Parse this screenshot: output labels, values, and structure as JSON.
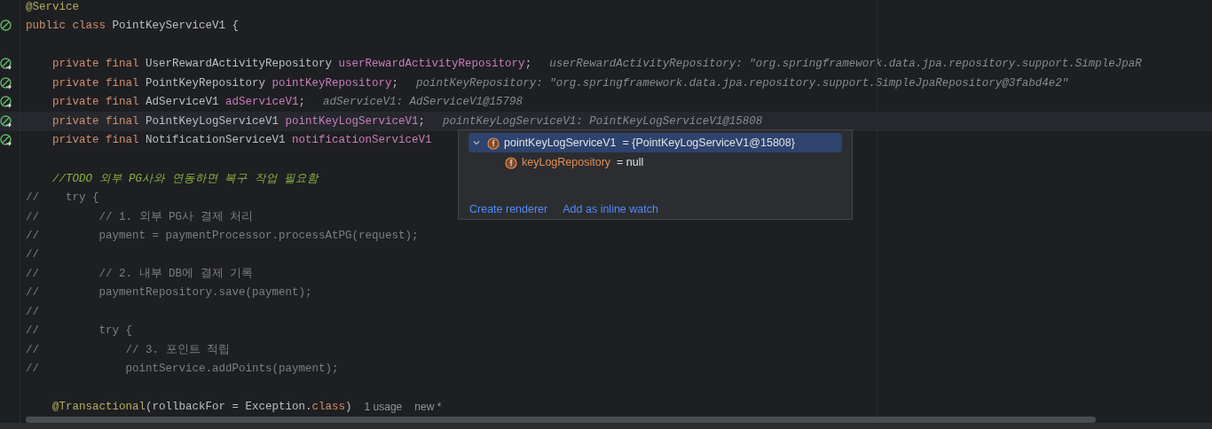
{
  "editor": {
    "lines": [
      {
        "kind": "code",
        "current": false,
        "tokens": [
          {
            "kind": "annotation",
            "text": "@Service"
          }
        ]
      },
      {
        "kind": "code",
        "gutter_icon": true,
        "current": false,
        "tokens": [
          {
            "kind": "keyword",
            "text": "public class "
          },
          {
            "kind": "plain",
            "text": "PointKeyServiceV1 {"
          }
        ]
      },
      {
        "kind": "blank"
      },
      {
        "kind": "code",
        "gutter_icon": true,
        "current": false,
        "tokens": [
          {
            "kind": "keyword",
            "text": "    private final "
          },
          {
            "kind": "plain",
            "text": "UserRewardActivityRepository "
          },
          {
            "kind": "field",
            "text": "userRewardActivityRepository"
          },
          {
            "kind": "plain",
            "text": ";"
          }
        ],
        "hint": "userRewardActivityRepository: \"org.springframework.data.jpa.repository.support.SimpleJpaR"
      },
      {
        "kind": "code",
        "gutter_icon": true,
        "current": false,
        "tokens": [
          {
            "kind": "keyword",
            "text": "    private final "
          },
          {
            "kind": "plain",
            "text": "PointKeyRepository "
          },
          {
            "kind": "field",
            "text": "pointKeyRepository"
          },
          {
            "kind": "plain",
            "text": ";"
          }
        ],
        "hint": "pointKeyRepository: \"org.springframework.data.jpa.repository.support.SimpleJpaRepository@3fabd4e2\""
      },
      {
        "kind": "code",
        "gutter_icon": true,
        "current": false,
        "tokens": [
          {
            "kind": "keyword",
            "text": "    private final "
          },
          {
            "kind": "plain",
            "text": "AdServiceV1 "
          },
          {
            "kind": "field",
            "text": "adServiceV1"
          },
          {
            "kind": "plain",
            "text": ";"
          }
        ],
        "hint": "adServiceV1: AdServiceV1@15798"
      },
      {
        "kind": "code",
        "gutter_icon": true,
        "current": true,
        "tokens": [
          {
            "kind": "keyword",
            "text": "    private final "
          },
          {
            "kind": "plain",
            "text": "PointKeyLogServiceV1 "
          },
          {
            "kind": "field",
            "text": "pointKeyLogServiceV1"
          },
          {
            "kind": "plain",
            "text": ";"
          }
        ],
        "hint": "pointKeyLogServiceV1: PointKeyLogServiceV1@15808"
      },
      {
        "kind": "code",
        "gutter_icon": true,
        "current": false,
        "tokens": [
          {
            "kind": "keyword",
            "text": "    private final "
          },
          {
            "kind": "plain",
            "text": "NotificationServiceV1 "
          },
          {
            "kind": "field",
            "text": "notificationServiceV1"
          }
        ]
      },
      {
        "kind": "blank"
      },
      {
        "kind": "code",
        "current": false,
        "tokens": [
          {
            "kind": "todo",
            "text": "    //TODO 외부 PG사와 연동하면 복구 작업 필요함"
          }
        ]
      },
      {
        "kind": "code",
        "current": false,
        "tokens": [
          {
            "kind": "comment",
            "text": "//    try {"
          }
        ]
      },
      {
        "kind": "code",
        "current": false,
        "tokens": [
          {
            "kind": "comment",
            "text": "//         // 1. 외부 PG사 결제 처리"
          }
        ]
      },
      {
        "kind": "code",
        "current": false,
        "tokens": [
          {
            "kind": "comment",
            "text": "//         payment = paymentProcessor.processAtPG(request);"
          }
        ]
      },
      {
        "kind": "code",
        "current": false,
        "tokens": [
          {
            "kind": "comment",
            "text": "//"
          }
        ]
      },
      {
        "kind": "code",
        "current": false,
        "tokens": [
          {
            "kind": "comment",
            "text": "//         // 2. 내부 DB에 결제 기록"
          }
        ]
      },
      {
        "kind": "code",
        "current": false,
        "tokens": [
          {
            "kind": "comment",
            "text": "//         paymentRepository.save(payment);"
          }
        ]
      },
      {
        "kind": "code",
        "current": false,
        "tokens": [
          {
            "kind": "comment",
            "text": "//"
          }
        ]
      },
      {
        "kind": "code",
        "current": false,
        "tokens": [
          {
            "kind": "comment",
            "text": "//         try {"
          }
        ]
      },
      {
        "kind": "code",
        "current": false,
        "tokens": [
          {
            "kind": "comment",
            "text": "//             // 3. 포인트 적립"
          }
        ]
      },
      {
        "kind": "code",
        "current": false,
        "tokens": [
          {
            "kind": "comment",
            "text": "//             pointService.addPoints(payment);"
          }
        ]
      },
      {
        "kind": "blank"
      },
      {
        "kind": "code",
        "current": false,
        "tokens": [
          {
            "kind": "annotation",
            "text": "    @Transactional"
          },
          {
            "kind": "plain",
            "text": "(rollbackFor = Exception."
          },
          {
            "kind": "keyword",
            "text": "class"
          },
          {
            "kind": "plain",
            "text": ")"
          }
        ],
        "usages": "1 usage",
        "author": "new *"
      }
    ]
  },
  "debug_popup": {
    "rows": [
      {
        "name": "pointKeyLogServiceV1",
        "value": "= {PointKeyLogServiceV1@15808}",
        "expanded": true,
        "selected": true,
        "children": [
          {
            "name": "keyLogRepository",
            "value": "= null",
            "selected": false
          }
        ]
      }
    ],
    "links": [
      "Create renderer",
      "Add as inline watch"
    ]
  }
}
